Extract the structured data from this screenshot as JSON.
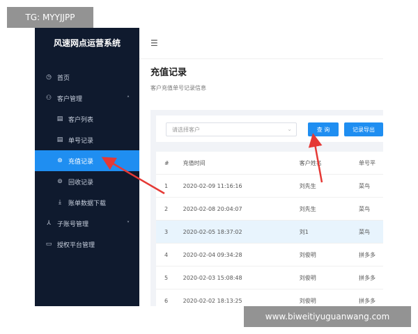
{
  "watermarks": {
    "top_left": "TG: MYYJJPP",
    "bottom_right": "www.biweitiyuguanwang.com"
  },
  "sidebar": {
    "title": "风速网点运营系统",
    "items": [
      {
        "label": "首页",
        "icon": "dashboard-icon"
      },
      {
        "label": "客户管理",
        "icon": "users-icon"
      },
      {
        "label": "客户列表",
        "icon": "doc-icon"
      },
      {
        "label": "单号记录",
        "icon": "doc-icon"
      },
      {
        "label": "充值记录",
        "icon": "recharge-icon",
        "active": true
      },
      {
        "label": "回收记录",
        "icon": "recycle-icon"
      },
      {
        "label": "账单数据下载",
        "icon": "download-icon"
      },
      {
        "label": "子账号管理",
        "icon": "sub-account-icon"
      },
      {
        "label": "授权平台管理",
        "icon": "platform-icon"
      }
    ]
  },
  "header": {
    "title": "充值记录",
    "subtitle": "客户充值单号记录信息"
  },
  "filter": {
    "placeholder": "请选择客户",
    "search_label": "查 询",
    "export_label": "记录导出"
  },
  "table": {
    "columns": [
      "#",
      "充值时间",
      "客户姓名",
      "单号平"
    ],
    "rows": [
      [
        "1",
        "2020-02-09 11:16:16",
        "刘先生",
        "菜鸟"
      ],
      [
        "2",
        "2020-02-08 20:04:07",
        "刘先生",
        "菜鸟"
      ],
      [
        "3",
        "2020-02-05 18:37:02",
        "刘1",
        "菜鸟"
      ],
      [
        "4",
        "2020-02-04 09:34:28",
        "刘俊明",
        "拼多多"
      ],
      [
        "5",
        "2020-02-03 15:08:48",
        "刘俊明",
        "拼多多"
      ],
      [
        "6",
        "2020-02-02 18:13:25",
        "刘俊明",
        "拼多多"
      ]
    ],
    "highlight_row": 2
  },
  "colors": {
    "sidebar_bg": "#0f1a2e",
    "accent": "#1f8ef1",
    "arrow": "#e53935"
  }
}
